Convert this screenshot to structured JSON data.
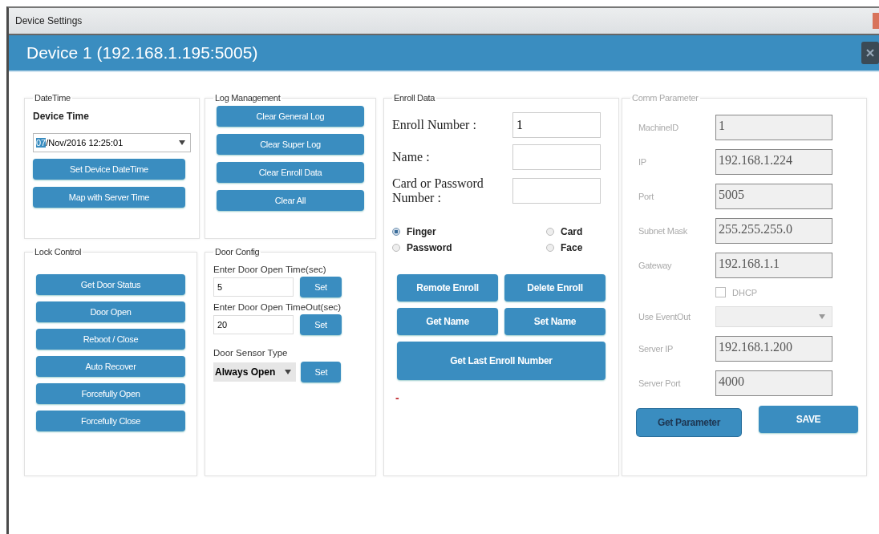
{
  "window": {
    "title": "Device Settings"
  },
  "header": {
    "title": "Device 1 (192.168.1.195:5005)"
  },
  "datetime": {
    "legend": "DateTime",
    "label": "Device Time",
    "picker": {
      "segments": [
        {
          "text": "07",
          "selected": true
        },
        {
          "text": "/Nov/2016 12:25:01",
          "selected": false
        }
      ]
    },
    "buttons": [
      "Set Device DateTime",
      "Map with Server Time"
    ]
  },
  "log_management": {
    "legend": "Log Management",
    "buttons": [
      "Clear General Log",
      "Clear Super Log",
      "Clear Enroll Data",
      "Clear All"
    ]
  },
  "lock_control": {
    "legend": "Lock Control",
    "buttons": [
      "Get Door Status",
      "Door Open",
      "Reboot / Close",
      "Auto Recover",
      "Forcefully Open",
      "Forcefully Close"
    ]
  },
  "door_config": {
    "legend": "Door Config",
    "fields": [
      {
        "label": "Enter Door Open Time(sec)",
        "value": "5",
        "button": "Set"
      },
      {
        "label": "Enter Door Open TimeOut(sec)",
        "value": "20",
        "button": "Set"
      }
    ],
    "sensor": {
      "label": "Door Sensor Type",
      "value": "Always Open",
      "button": "Set"
    }
  },
  "enroll_data": {
    "legend": "Enroll Data",
    "fields": [
      {
        "label": "Enroll Number :",
        "value": "1"
      },
      {
        "label": "Name :"
      },
      {
        "label": "Card or Password Number :"
      }
    ],
    "modes": [
      {
        "label": "Finger",
        "selected": true
      },
      {
        "label": "Card",
        "selected": false
      },
      {
        "label": "Password",
        "selected": false
      },
      {
        "label": "Face",
        "selected": false
      }
    ],
    "buttons": [
      "Remote Enroll",
      "Delete Enroll",
      "Get Name",
      "Set Name"
    ],
    "wide_button": "Get Last Enroll Number",
    "status": "-"
  },
  "comm_parameter": {
    "legend": "Comm Parameter",
    "disabled": true,
    "rows": [
      {
        "kind": "field",
        "label": "MachineID",
        "value": "1"
      },
      {
        "kind": "field",
        "label": "IP",
        "value": "192.168.1.224"
      },
      {
        "kind": "field",
        "label": "Port",
        "value": "5005"
      },
      {
        "kind": "field",
        "label": "Subnet Mask",
        "value": "255.255.255.0"
      },
      {
        "kind": "field",
        "label": "Gateway",
        "value": "192.168.1.1"
      },
      {
        "kind": "checkbox",
        "label": "DHCP",
        "checked": false
      },
      {
        "kind": "select",
        "label": "Use EventOut"
      },
      {
        "kind": "field",
        "label": "Server IP",
        "value": "192.168.1.200"
      },
      {
        "kind": "field",
        "label": "Server Port",
        "value": "4000"
      }
    ],
    "buttons": [
      {
        "label": "Get Parameter",
        "focused": true
      },
      {
        "label": "SAVE",
        "focused": false
      }
    ]
  }
}
